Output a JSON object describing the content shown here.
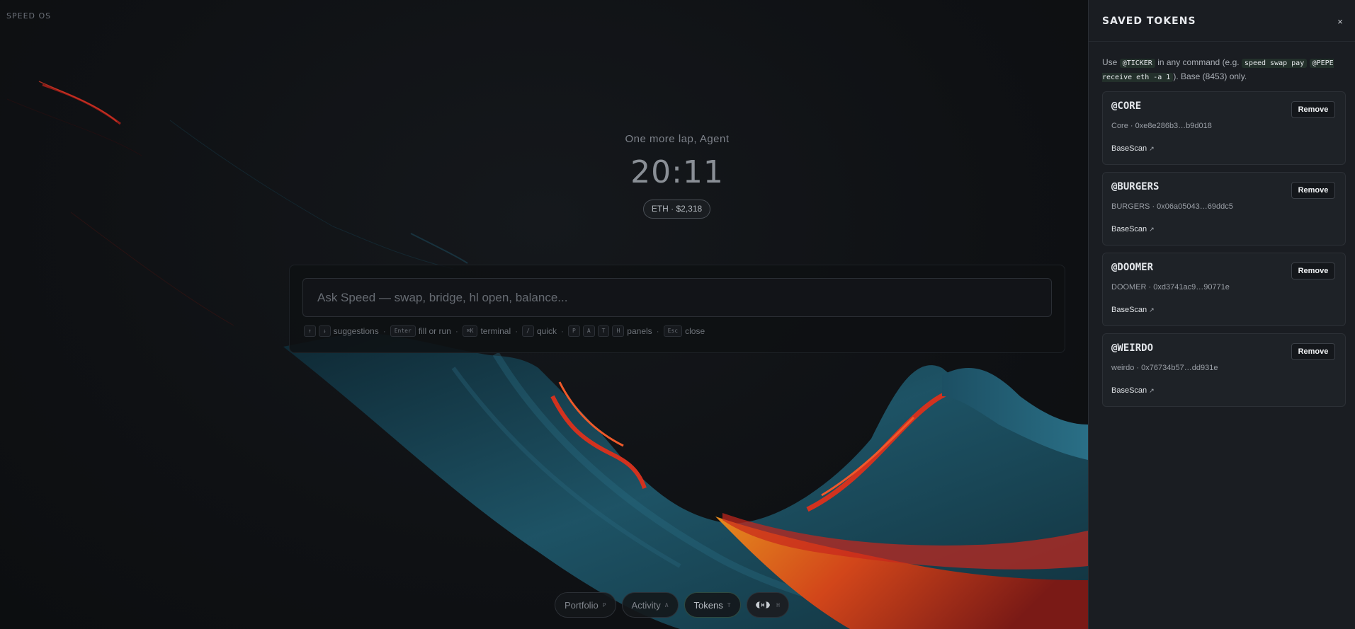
{
  "brand": "SPEED OS",
  "greeting": "One more lap, Agent",
  "clock": "20:11",
  "price_pill": "ETH · $2,318",
  "command": {
    "placeholder": "Ask Speed — swap, bridge, hl open, balance...",
    "hints": {
      "k_up": "↑",
      "k_down": "↓",
      "suggestions": "suggestions",
      "k_enter": "Enter",
      "fill_or_run": "fill or run",
      "k_cmdk": "⌘K",
      "terminal": "terminal",
      "k_slash": "/",
      "quick": "quick",
      "k_p": "P",
      "k_a": "A",
      "k_t": "T",
      "k_h": "H",
      "panels": "panels",
      "k_esc": "Esc",
      "close": "close",
      "dot": "·"
    }
  },
  "dock": {
    "portfolio": {
      "label": "Portfolio",
      "key": "P"
    },
    "activity": {
      "label": "Activity",
      "key": "A"
    },
    "tokens": {
      "label": "Tokens",
      "key": "T"
    },
    "speed": {
      "icon": "speed-logo-icon",
      "key": "H"
    }
  },
  "panel": {
    "title": "SAVED TOKENS",
    "close": "×",
    "desc_use": "Use",
    "desc_ticker_code": "@TICKER",
    "desc_in_any": "in any command (e.g.",
    "desc_example_code_1": "speed swap pay",
    "desc_example_code_2": "@PEPE receive eth -a 1",
    "desc_tail": "). Base (8453) only.",
    "remove_label": "Remove",
    "link_label": "BaseScan",
    "link_arrow": "↗",
    "tokens": [
      {
        "ticker": "@CORE",
        "address": "Core · 0xe8e286b3…b9d018"
      },
      {
        "ticker": "@BURGERS",
        "address": "BURGERS · 0x06a05043…69ddc5"
      },
      {
        "ticker": "@DOOMER",
        "address": "DOOMER · 0xd3741ac9…90771e"
      },
      {
        "ticker": "@WEIRDO",
        "address": "weirdo · 0x76734b57…dd931e"
      }
    ]
  },
  "colors": {
    "background": "#101215",
    "panel": "#1a1d22",
    "accent_red": "#c8261c",
    "accent_orange": "#e0641c",
    "accent_teal": "#1f5a6e",
    "code_bg": "#23302b"
  }
}
